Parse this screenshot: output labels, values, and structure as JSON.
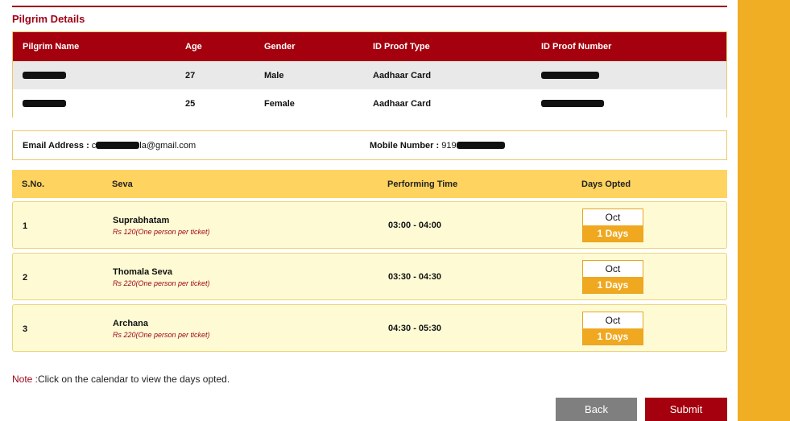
{
  "section_title": "Pilgrim Details",
  "pilgrim_table": {
    "headers": [
      "Pilgrim Name",
      "Age",
      "Gender",
      "ID Proof Type",
      "ID Proof Number"
    ],
    "rows": [
      {
        "age": "27",
        "gender": "Male",
        "id_type": "Aadhaar Card"
      },
      {
        "age": "25",
        "gender": "Female",
        "id_type": "Aadhaar Card"
      }
    ]
  },
  "contact": {
    "email_label": "Email Address :",
    "email_prefix": "c",
    "email_suffix": "la@gmail.com",
    "mobile_label": "Mobile Number :",
    "mobile_prefix": "919"
  },
  "seva_table": {
    "headers": [
      "S.No.",
      "Seva",
      "Performing Time",
      "Days Opted"
    ],
    "rows": [
      {
        "sno": "1",
        "name": "Suprabhatam",
        "price": "Rs 120(One person per ticket)",
        "time": "03:00 - 04:00",
        "month": "Oct",
        "days": "1 Days"
      },
      {
        "sno": "2",
        "name": "Thomala Seva",
        "price": "Rs 220(One person per ticket)",
        "time": "03:30 - 04:30",
        "month": "Oct",
        "days": "1 Days"
      },
      {
        "sno": "3",
        "name": "Archana",
        "price": "Rs 220(One person per ticket)",
        "time": "04:30 - 05:30",
        "month": "Oct",
        "days": "1 Days"
      }
    ]
  },
  "note": {
    "label": "Note :",
    "text": "Click on the calendar to view the days opted."
  },
  "buttons": {
    "back": "Back",
    "submit": "Submit"
  },
  "colors": {
    "brand_red": "#a4000e",
    "accent_gold": "#f0ae24",
    "header_yellow": "#fed35f",
    "row_cream": "#fefbd4"
  }
}
